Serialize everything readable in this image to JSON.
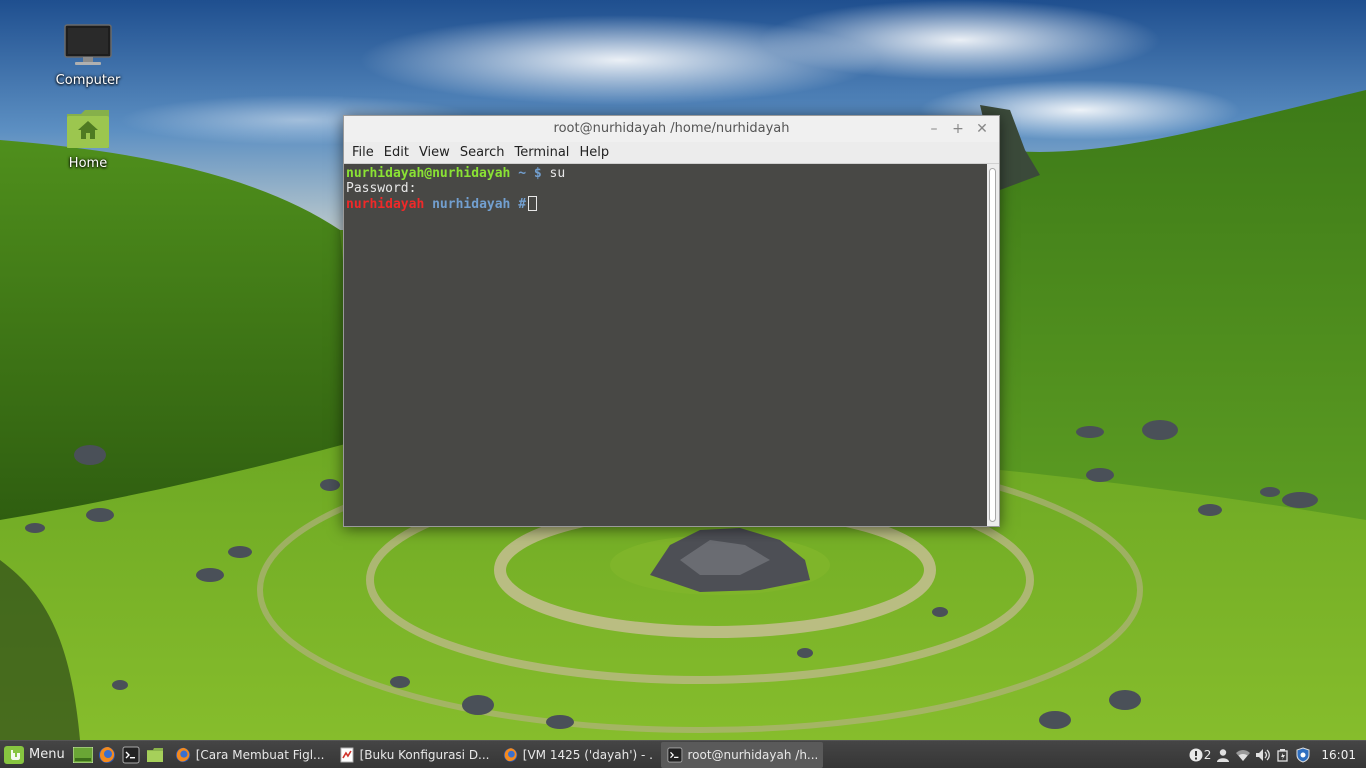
{
  "desktop": {
    "icons": [
      {
        "label": "Computer"
      },
      {
        "label": "Home"
      }
    ]
  },
  "terminal": {
    "title": "root@nurhidayah /home/nurhidayah",
    "menu": [
      "File",
      "Edit",
      "View",
      "Search",
      "Terminal",
      "Help"
    ],
    "lines": {
      "l1_userhost": "nurhidayah@nurhidayah",
      "l1_path": "~ $",
      "l1_cmd": " su",
      "l2_text": "Password:",
      "l3_user": "nurhidayah",
      "l3_dir": "nurhidayah #"
    },
    "colors": {
      "prompt_green": "#8ae234",
      "prompt_blue": "#729fcf",
      "root_red": "#ef2929"
    }
  },
  "taskbar": {
    "menu_label": "Menu",
    "launchers": [
      "show-desktop-icon",
      "firefox-icon",
      "terminal-icon",
      "files-icon"
    ],
    "tasks": [
      {
        "label": "[Cara Membuat Figl...",
        "icon": "firefox-icon"
      },
      {
        "label": "[Buku Konfigurasi D...",
        "icon": "document-icon"
      },
      {
        "label": "[VM 1425 ('dayah') - ...",
        "icon": "firefox-icon"
      },
      {
        "label": "root@nurhidayah /h...",
        "icon": "terminal-icon"
      }
    ],
    "tray": {
      "notification_count": "2",
      "clock": "16:01"
    }
  }
}
